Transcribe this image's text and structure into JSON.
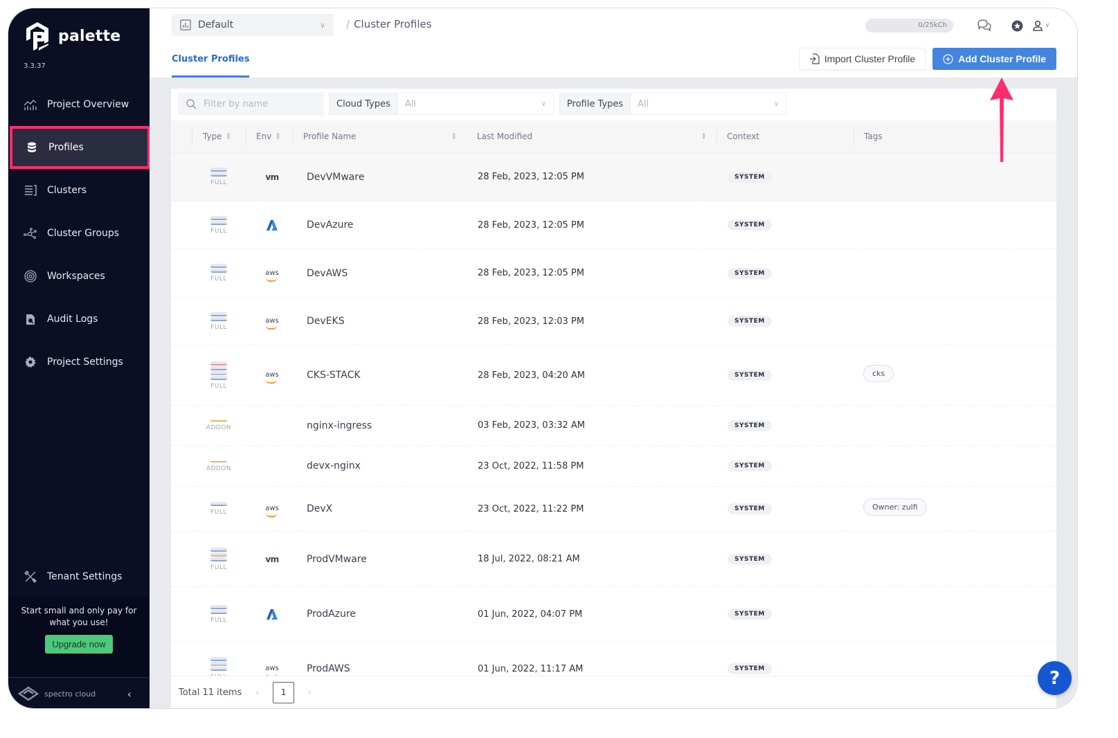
{
  "app": {
    "name": "palette",
    "version": "3.3.37"
  },
  "sidebar": {
    "items": [
      {
        "label": "Project Overview",
        "icon": "chart-icon",
        "active": false
      },
      {
        "label": "Profiles",
        "icon": "database-stack-icon",
        "active": true
      },
      {
        "label": "Clusters",
        "icon": "clusters-icon",
        "active": false
      },
      {
        "label": "Cluster Groups",
        "icon": "cluster-groups-icon",
        "active": false
      },
      {
        "label": "Workspaces",
        "icon": "workspaces-icon",
        "active": false
      },
      {
        "label": "Audit Logs",
        "icon": "audit-log-icon",
        "active": false
      },
      {
        "label": "Project Settings",
        "icon": "gear-icon",
        "active": false
      }
    ],
    "tenant_settings": "Tenant Settings",
    "promo_text": "Start small and only pay for what you use!",
    "upgrade_label": "Upgrade now",
    "footer_brand": "spectro cloud"
  },
  "header": {
    "project": "Default",
    "breadcrumb": "Cluster Profiles",
    "credits": "0/25kCh"
  },
  "tabs": [
    {
      "label": "Cluster Profiles",
      "active": true
    }
  ],
  "actions": {
    "import_label": "Import Cluster Profile",
    "add_label": "Add Cluster Profile"
  },
  "filters": {
    "search_placeholder": "Filter by name",
    "cloud_types_label": "Cloud Types",
    "cloud_types_value": "All",
    "profile_types_label": "Profile Types",
    "profile_types_value": "All"
  },
  "table": {
    "columns": [
      "Type",
      "Env",
      "Profile Name",
      "Last Modified",
      "Context",
      "Tags"
    ],
    "rows": [
      {
        "type": "FULL",
        "env": "vm",
        "name": "DevVMware",
        "modified": "28 Feb, 2023, 12:05 PM",
        "context": "SYSTEM",
        "tag": ""
      },
      {
        "type": "FULL",
        "env": "azure",
        "name": "DevAzure",
        "modified": "28 Feb, 2023, 12:05 PM",
        "context": "SYSTEM",
        "tag": ""
      },
      {
        "type": "FULL",
        "env": "aws",
        "name": "DevAWS",
        "modified": "28 Feb, 2023, 12:05 PM",
        "context": "SYSTEM",
        "tag": ""
      },
      {
        "type": "FULL",
        "env": "aws",
        "name": "DevEKS",
        "modified": "28 Feb, 2023, 12:03 PM",
        "context": "SYSTEM",
        "tag": ""
      },
      {
        "type": "FULL",
        "env": "aws",
        "name": "CKS-STACK",
        "modified": "28 Feb, 2023, 04:20 AM",
        "context": "SYSTEM",
        "tag": "cks"
      },
      {
        "type": "ADDON",
        "env": "",
        "name": "nginx-ingress",
        "modified": "03 Feb, 2023, 03:32 AM",
        "context": "SYSTEM",
        "tag": ""
      },
      {
        "type": "ADDON",
        "env": "",
        "name": "devx-nginx",
        "modified": "23 Oct, 2022, 11:58 PM",
        "context": "SYSTEM",
        "tag": ""
      },
      {
        "type": "FULL",
        "env": "aws",
        "name": "DevX",
        "modified": "23 Oct, 2022, 11:22 PM",
        "context": "SYSTEM",
        "tag": "Owner: zulfi"
      },
      {
        "type": "FULL",
        "env": "vm",
        "name": "ProdVMware",
        "modified": "18 Jul, 2022, 08:21 AM",
        "context": "SYSTEM",
        "tag": ""
      },
      {
        "type": "FULL",
        "env": "azure",
        "name": "ProdAzure",
        "modified": "01 Jun, 2022, 04:07 PM",
        "context": "SYSTEM",
        "tag": ""
      },
      {
        "type": "FULL",
        "env": "aws",
        "name": "ProdAWS",
        "modified": "01 Jun, 2022, 11:17 AM",
        "context": "SYSTEM",
        "tag": ""
      }
    ]
  },
  "pagination": {
    "total_label": "Total 11 items",
    "current_page": "1"
  },
  "help_label": "?",
  "colors": {
    "accent": "#4485e0",
    "highlight": "#ff2d6f",
    "sidebar_bg": "#0b0f24",
    "upgrade": "#4cc97a"
  }
}
